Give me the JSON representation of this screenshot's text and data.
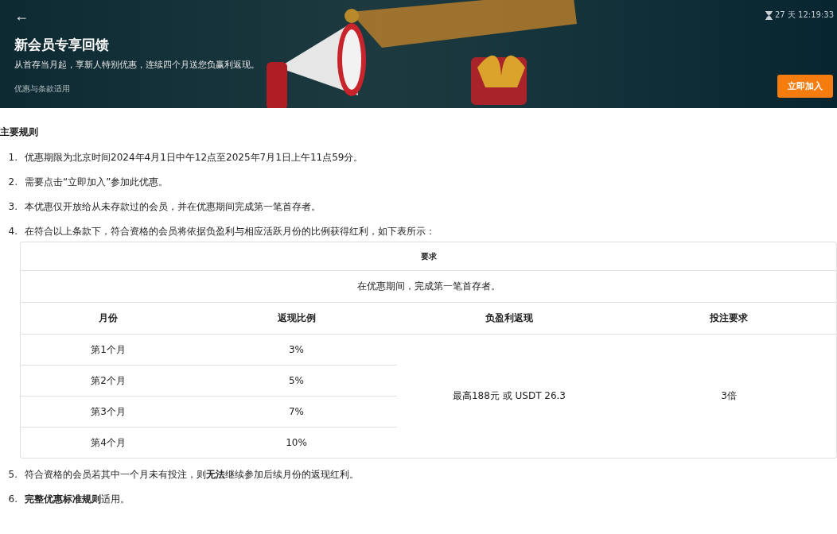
{
  "banner": {
    "back": "←",
    "timer": "27 天 12:19:33",
    "title": "新会员专享回馈",
    "subtitle": "从首存当月起，享新人特别优惠，连续四个月送您负赢利返现。",
    "terms_link": "优惠与条款适用",
    "join_button": "立即加入"
  },
  "rules": {
    "heading": "主要规则",
    "items": [
      {
        "number": "1.",
        "text": "优惠期限为北京时间2024年4月1日中午12点至2025年7月1日上午11点59分。"
      },
      {
        "number": "2.",
        "text": "需要点击“立即加入”参加此优惠。"
      },
      {
        "number": "3.",
        "text": "本优惠仅开放给从未存款过的会员，并在优惠期间完成第一笔首存者。"
      },
      {
        "number": "4.",
        "text": "在符合以上条款下，符合资格的会员将依据负盈利与相应活跃月份的比例获得红利，如下表所示：",
        "table": {
          "title": "要求",
          "requirement": "在优惠期间，完成第一笔首存者。",
          "columns": [
            "月份",
            "返现比例",
            "负盈利返现",
            "投注要求"
          ],
          "rows": [
            {
              "month": "第1个月",
              "ratio": "3%"
            },
            {
              "month": "第2个月",
              "ratio": "5%"
            },
            {
              "month": "第3个月",
              "ratio": "7%"
            },
            {
              "month": "第4个月",
              "ratio": "10%"
            }
          ],
          "rebate": "最高188元 或 USDT 26.3",
          "wager": "3倍"
        }
      },
      {
        "number": "5.",
        "text": "符合资格的会员若其中一个月未有投注，则**无法**继续参加后续月份的返现红利。"
      },
      {
        "number": "6.",
        "text": "**完整优惠标准规则**适用。"
      }
    ]
  }
}
